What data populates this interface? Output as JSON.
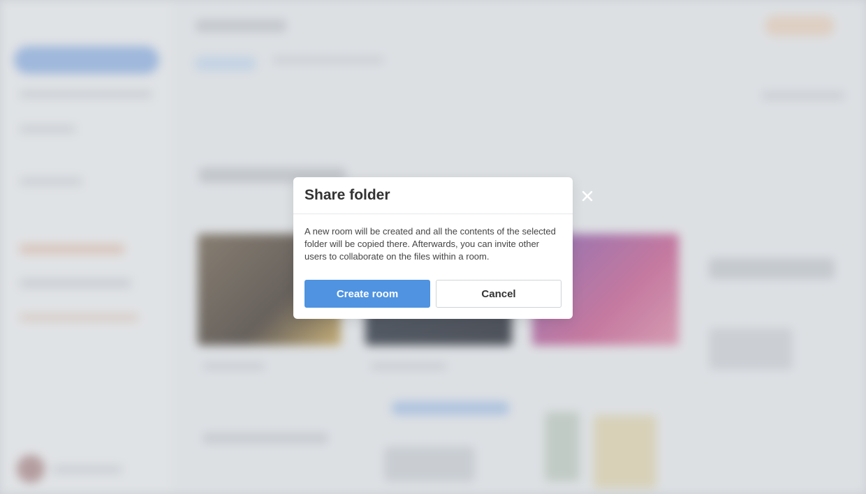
{
  "dialog": {
    "title": "Share folder",
    "message": "A new room will be created and all the contents of the selected folder will be copied there. Afterwards, you can invite other users to collaborate on the files within a room.",
    "primary_label": "Create room",
    "secondary_label": "Cancel",
    "close_icon": "close-icon"
  },
  "colors": {
    "primary": "#4f93e1",
    "backdrop": "#d3d6da",
    "dialog_bg": "#ffffff"
  }
}
